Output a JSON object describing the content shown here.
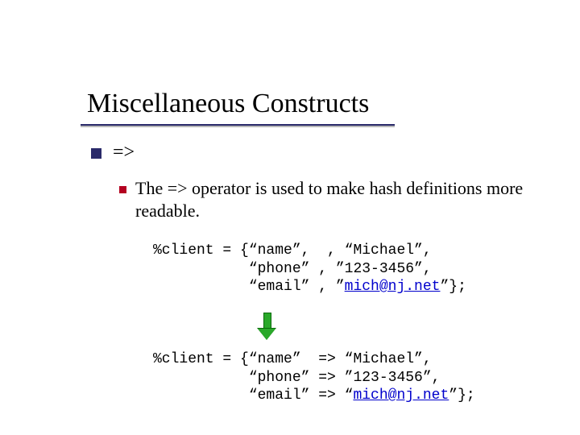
{
  "title": "Miscellaneous Constructs",
  "level1": {
    "text": "=>"
  },
  "level2": {
    "text": "The => operator is used to make hash definitions more readable."
  },
  "code_block_1": {
    "l1a": "%client = {“name”,  , “Michael”,",
    "l2a": "           “phone” , ”123-3456”,",
    "l3a_pre": "           “email” , ”",
    "l3a_link": "mich@nj.net",
    "l3a_post": "”};"
  },
  "code_block_2": {
    "l1a": "%client = {“name”  => “Michael”,",
    "l2a": "           “phone” => ”123-3456”,",
    "l3a_pre": "           “email” => “",
    "l3a_link": "mich@nj.net",
    "l3a_post": "”};"
  }
}
